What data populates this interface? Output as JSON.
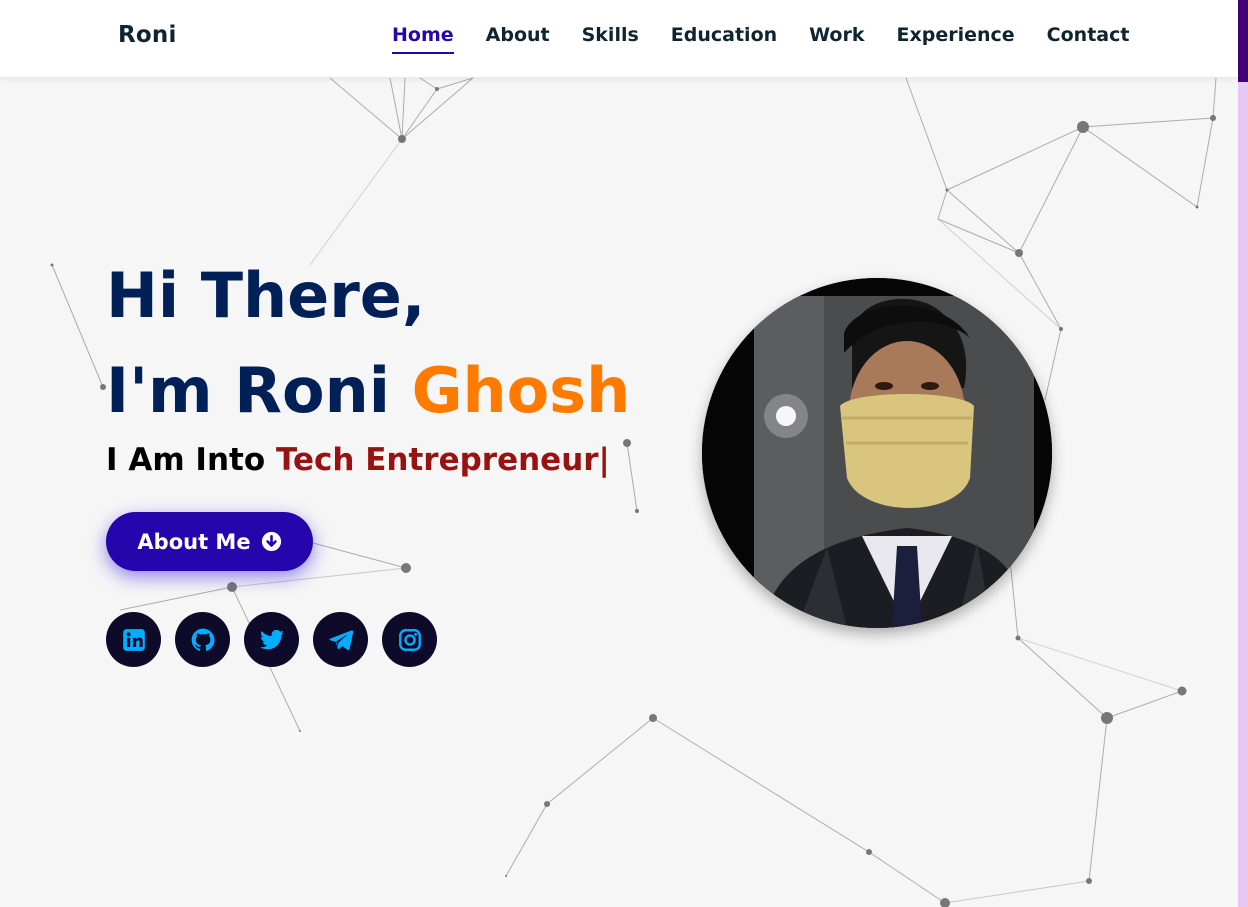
{
  "brand": "Roni",
  "nav": {
    "items": [
      {
        "label": "Home",
        "active": true
      },
      {
        "label": "About"
      },
      {
        "label": "Skills"
      },
      {
        "label": "Education"
      },
      {
        "label": "Work"
      },
      {
        "label": "Experience"
      },
      {
        "label": "Contact"
      }
    ]
  },
  "hero": {
    "greeting": "Hi There,",
    "intro": "I'm Roni ",
    "last_name": "Ghosh",
    "typed_prefix": "I Am Into ",
    "typed_value": "Tech Entrepreneur|",
    "button_label": "About Me",
    "button_icon": "arrow-circle-down-icon",
    "socials": [
      {
        "name": "linkedin-icon"
      },
      {
        "name": "github-icon"
      },
      {
        "name": "twitter-icon"
      },
      {
        "name": "telegram-icon"
      },
      {
        "name": "instagram-icon"
      }
    ],
    "avatar": "profile-photo"
  },
  "colors": {
    "primary_blue": "#2506ad",
    "heading_navy": "#002057",
    "accent_orange": "#ff7b00",
    "typed_red": "#991212",
    "social_bg": "#0e0a2a",
    "social_icon": "#00aeff",
    "scrollbar_track": "#e6c8f3",
    "scrollbar_thumb": "#420177"
  }
}
